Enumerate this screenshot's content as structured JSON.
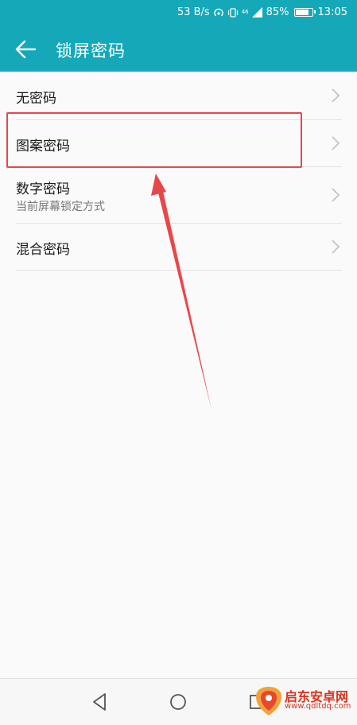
{
  "status_bar": {
    "speed": "53 B/s",
    "network_small": "46",
    "battery_percent": "85%",
    "battery_level": 0.85,
    "time": "13:05",
    "icons": [
      "hotspot-icon",
      "vibrate-icon",
      "signal-icon",
      "battery-icon"
    ]
  },
  "app_bar": {
    "title": "锁屏密码",
    "background": "#15a8b9"
  },
  "options": [
    {
      "label": "无密码",
      "sub": ""
    },
    {
      "label": "图案密码",
      "sub": ""
    },
    {
      "label": "数字密码",
      "sub": "当前屏幕锁定方式"
    },
    {
      "label": "混合密码",
      "sub": ""
    }
  ],
  "annotation": {
    "color": "#e8474a",
    "target": "图案密码"
  },
  "nav_bar": {
    "buttons": [
      "back-icon",
      "home-icon",
      "recents-icon"
    ]
  },
  "watermark": {
    "line1": "启东安卓网",
    "line2": "www.qdltdq.com"
  }
}
